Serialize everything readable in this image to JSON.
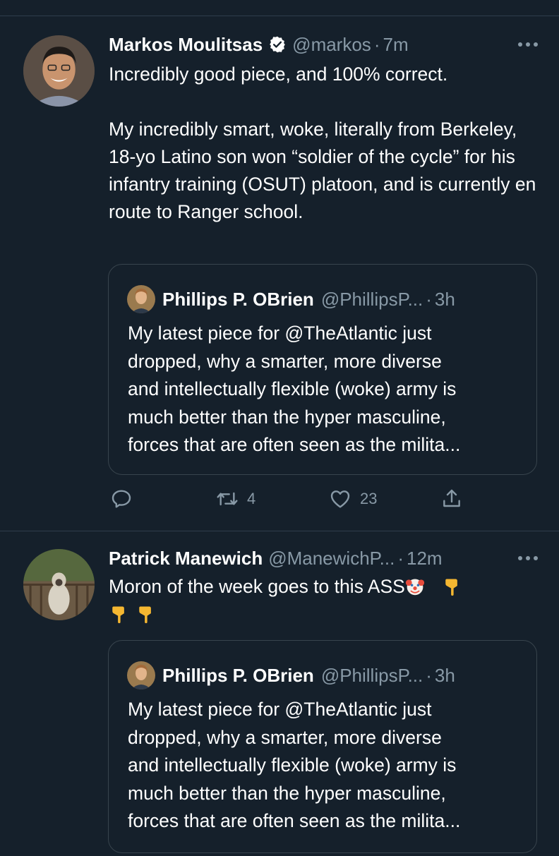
{
  "tweets": [
    {
      "author": {
        "name": "Markos Moulitsas",
        "handle": "@markos",
        "verified": true,
        "avatar": "man-portrait-avatar"
      },
      "time": "7m",
      "text": "Incredibly good piece, and 100% correct.\n\nMy incredibly smart, woke, literally from Berkeley, 18-yo Latino son won “soldier of the cycle” for his infantry training (OSUT) platoon, and is currently en route to Ranger school.",
      "quote": {
        "name": "Phillips P. OBrien",
        "handle": "@PhillipsP...",
        "time": "3h",
        "text": "My latest piece for @TheAtlantic just\ndropped, why a smarter, more diverse\nand intellectually flexible (woke) army is\nmuch better than the hyper masculine,\nforces that are often seen as the milita..."
      },
      "actions": {
        "reply_icon": "reply-icon",
        "retweet_icon": "retweet-icon",
        "retweets": "4",
        "like_icon": "heart-icon",
        "likes": "23",
        "share_icon": "share-icon"
      }
    },
    {
      "author": {
        "name": "Patrick Manewich",
        "handle": "@ManewichP...",
        "verified": false,
        "avatar": "dog-on-deck-avatar"
      },
      "time": "12m",
      "text": "Moron of the week goes to this ASS",
      "emojis": [
        "clown-face-emoji",
        "pointing-down-emoji",
        "pointing-down-emoji",
        "pointing-down-emoji"
      ],
      "quote": {
        "name": "Phillips P. OBrien",
        "handle": "@PhillipsP...",
        "time": "3h",
        "text": "My latest piece for @TheAtlantic just\ndropped, why a smarter, more diverse\nand intellectually flexible (woke) army is\nmuch better than the hyper masculine,\nforces that are often seen as the milita..."
      }
    }
  ],
  "separator": "·",
  "colors": {
    "background": "#15202b",
    "text": "#ffffff",
    "secondary": "#8899a6",
    "border": "#38444d",
    "verified": "#ffffff"
  }
}
